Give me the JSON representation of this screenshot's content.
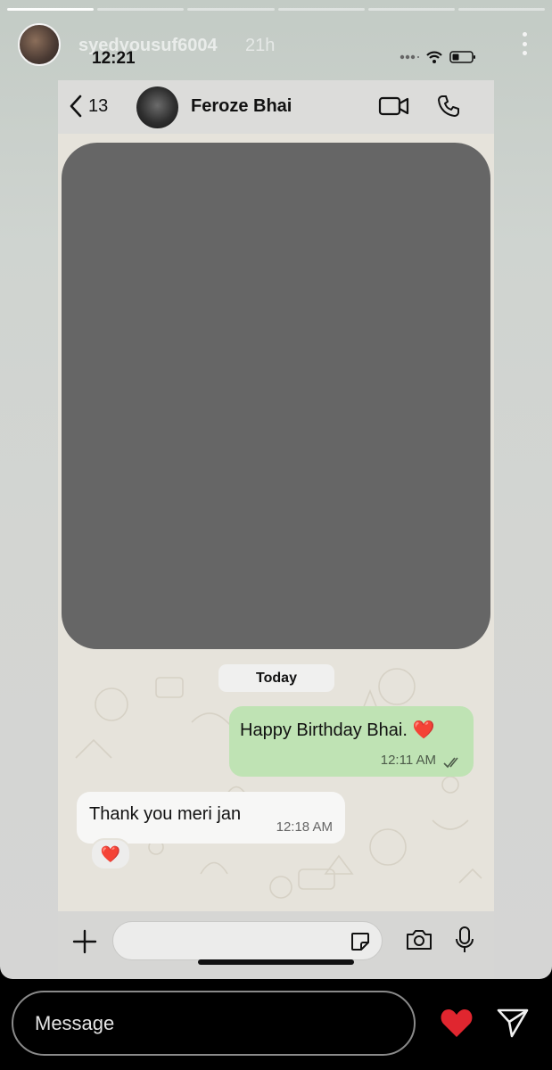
{
  "story": {
    "username": "syedyousuf6004",
    "time_ago": "21h",
    "progress_total": 6,
    "progress_done": 1
  },
  "screenshot": {
    "status_time": "12:21",
    "chat_header": {
      "back_count": "13",
      "contact_name": "Feroze Bhai"
    },
    "date_divider": "Today",
    "messages": [
      {
        "direction": "outgoing",
        "text": "Happy Birthday Bhai. ❤️",
        "time": "12:11 AM",
        "read": true
      },
      {
        "direction": "incoming",
        "text": "Thank you meri jan",
        "time": "12:18 AM",
        "reaction": "❤️"
      }
    ]
  },
  "reply": {
    "placeholder": "Message"
  },
  "colors": {
    "outgoing_bubble": "#bfe3b4",
    "incoming_bubble": "#f7f7f6",
    "heart": "#e0262f",
    "redacted": "#666666"
  }
}
